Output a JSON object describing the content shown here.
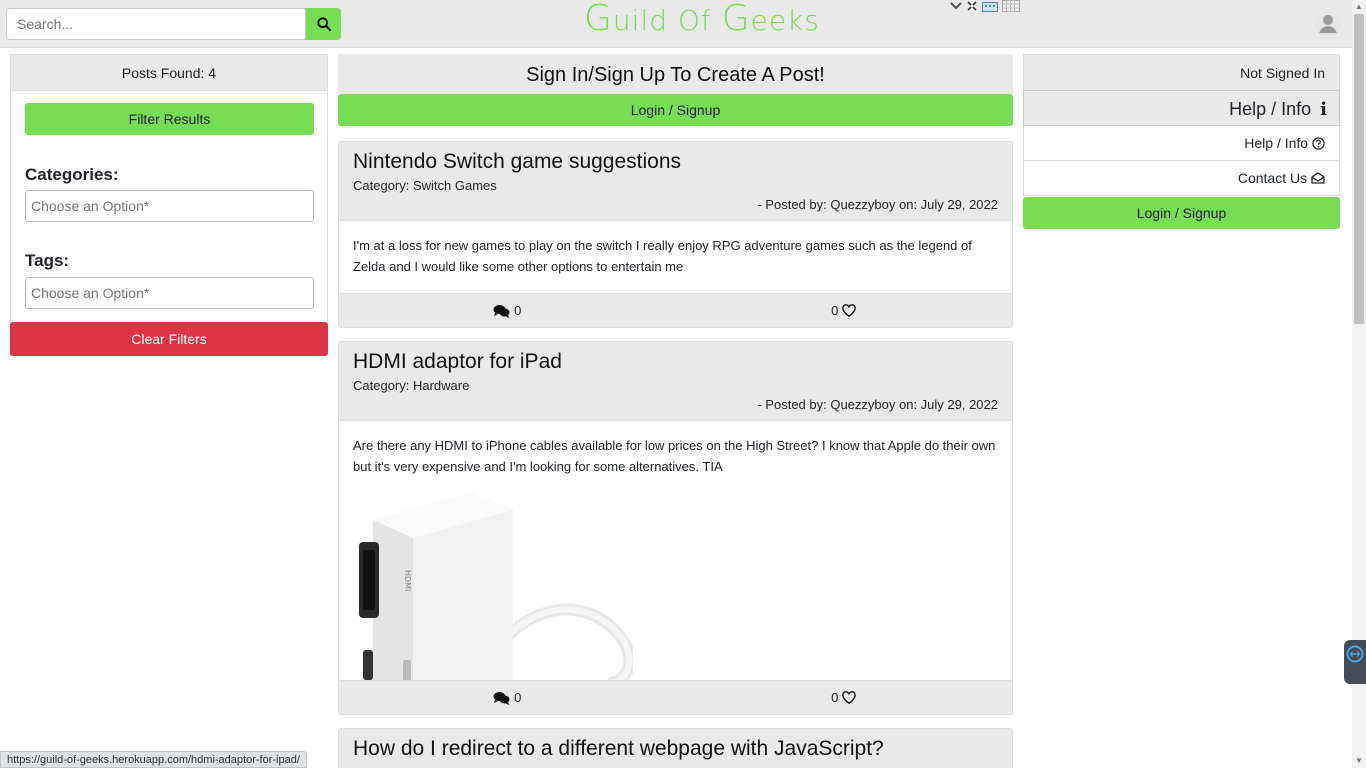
{
  "header": {
    "search_placeholder": "Search...",
    "logo_first": "G",
    "logo_middle": "uild Of ",
    "logo_second": "G",
    "logo_last": "eeks"
  },
  "left": {
    "posts_found": "Posts Found: 4",
    "filter_button": "Filter Results",
    "categories_label": "Categories:",
    "categories_placeholder": "Choose an Option*",
    "tags_label": "Tags:",
    "tags_placeholder": "Choose an Option*",
    "clear_button": "Clear Filters"
  },
  "center": {
    "signin_heading": "Sign In/Sign Up To Create A Post!",
    "login_button": "Login / Signup"
  },
  "posts": [
    {
      "title": "Nintendo Switch game suggestions",
      "category": "Category: Switch Games",
      "meta": "- Posted by: Quezzyboy on: July 29, 2022",
      "body": "I'm at a loss for new games to play on the switch I really enjoy RPG adventure games such as the legend of Zelda and I would like some other options to entertain me",
      "comments": "0",
      "likes": "0"
    },
    {
      "title": "HDMI adaptor for iPad",
      "category": "Category: Hardware",
      "meta": "- Posted by: Quezzyboy on: July 29, 2022",
      "body": "Are there any HDMI to iPhone cables available for low prices on the High Street? I know that Apple do their own but it's very expensive and I'm looking for some alternatives. TIA",
      "image_label": "HDMI",
      "comments": "0",
      "likes": "0"
    },
    {
      "title": "How do I redirect to a different webpage with JavaScript?"
    }
  ],
  "right": {
    "not_signed_in": "Not Signed In",
    "help_heading": "Help / Info",
    "help_item": "Help / Info",
    "contact_item": "Contact Us",
    "login_button": "Login / Signup"
  },
  "status_url": "https://guild-of-geeks.herokuapp.com/hdmi-adaptor-for-ipad/",
  "colors": {
    "accent": "#77dd55",
    "danger": "#dc3545",
    "panel": "#e9e9e9"
  }
}
